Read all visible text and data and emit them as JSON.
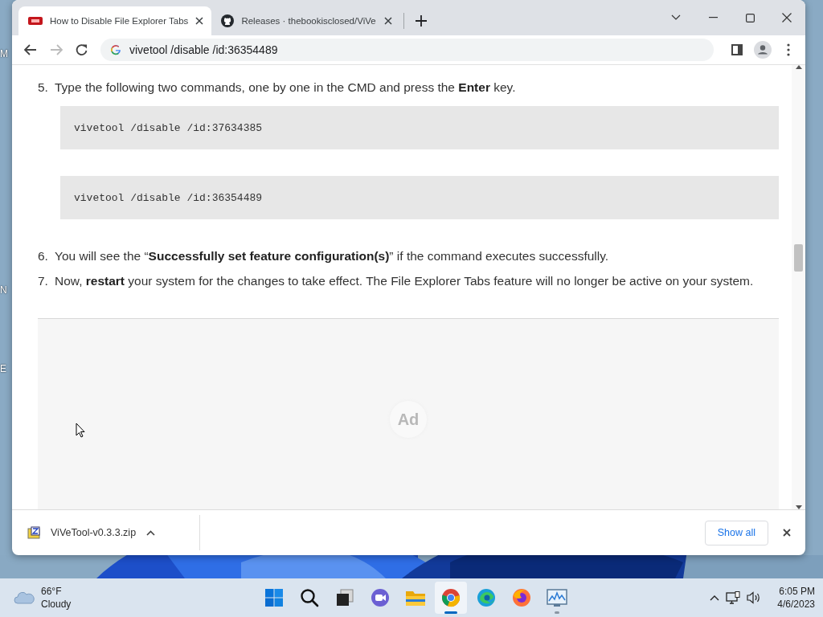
{
  "desktop_labels": [
    "M",
    "N",
    "E"
  ],
  "browser": {
    "tabs": [
      {
        "title": "How to Disable File Explorer Tabs",
        "kind": "site",
        "selected": true
      },
      {
        "title": "Releases · thebookisclosed/ViVe",
        "kind": "github",
        "selected": false
      }
    ],
    "address": "vivetool /disable /id:36354489"
  },
  "article": {
    "steps": [
      {
        "number": "5.",
        "text": "Type the following two commands, one by one in the CMD and press the **Enter** key.",
        "code": [
          "vivetool /disable /id:37634385",
          "vivetool /disable /id:36354489"
        ]
      },
      {
        "number": "6.",
        "text": "You will see the “**Successfully set feature configuration(s)**” if the command executes successfully."
      },
      {
        "number": "7.",
        "text": "Now, **restart** your system for the changes to take effect. The File Explorer Tabs feature will no longer be active on your system."
      }
    ],
    "ad_label": "Ad"
  },
  "downloads": {
    "file": "ViVeTool-v0.3.3.zip",
    "show_all": "Show all"
  },
  "taskbar": {
    "weather": {
      "temperature": "66°F",
      "condition": "Cloudy"
    },
    "apps": [
      {
        "kind": "start",
        "selected": false,
        "running": false
      },
      {
        "kind": "search",
        "selected": false,
        "running": false
      },
      {
        "kind": "taskview",
        "selected": false,
        "running": false
      },
      {
        "kind": "chat",
        "selected": false,
        "running": false
      },
      {
        "kind": "files",
        "selected": false,
        "running": false
      },
      {
        "kind": "chrome",
        "selected": true,
        "running": true
      },
      {
        "kind": "edge",
        "selected": false,
        "running": false
      },
      {
        "kind": "firefox",
        "selected": false,
        "running": false
      },
      {
        "kind": "monitor",
        "selected": false,
        "running": true
      }
    ],
    "time": "6:05 PM",
    "date": "4/6/2023"
  }
}
